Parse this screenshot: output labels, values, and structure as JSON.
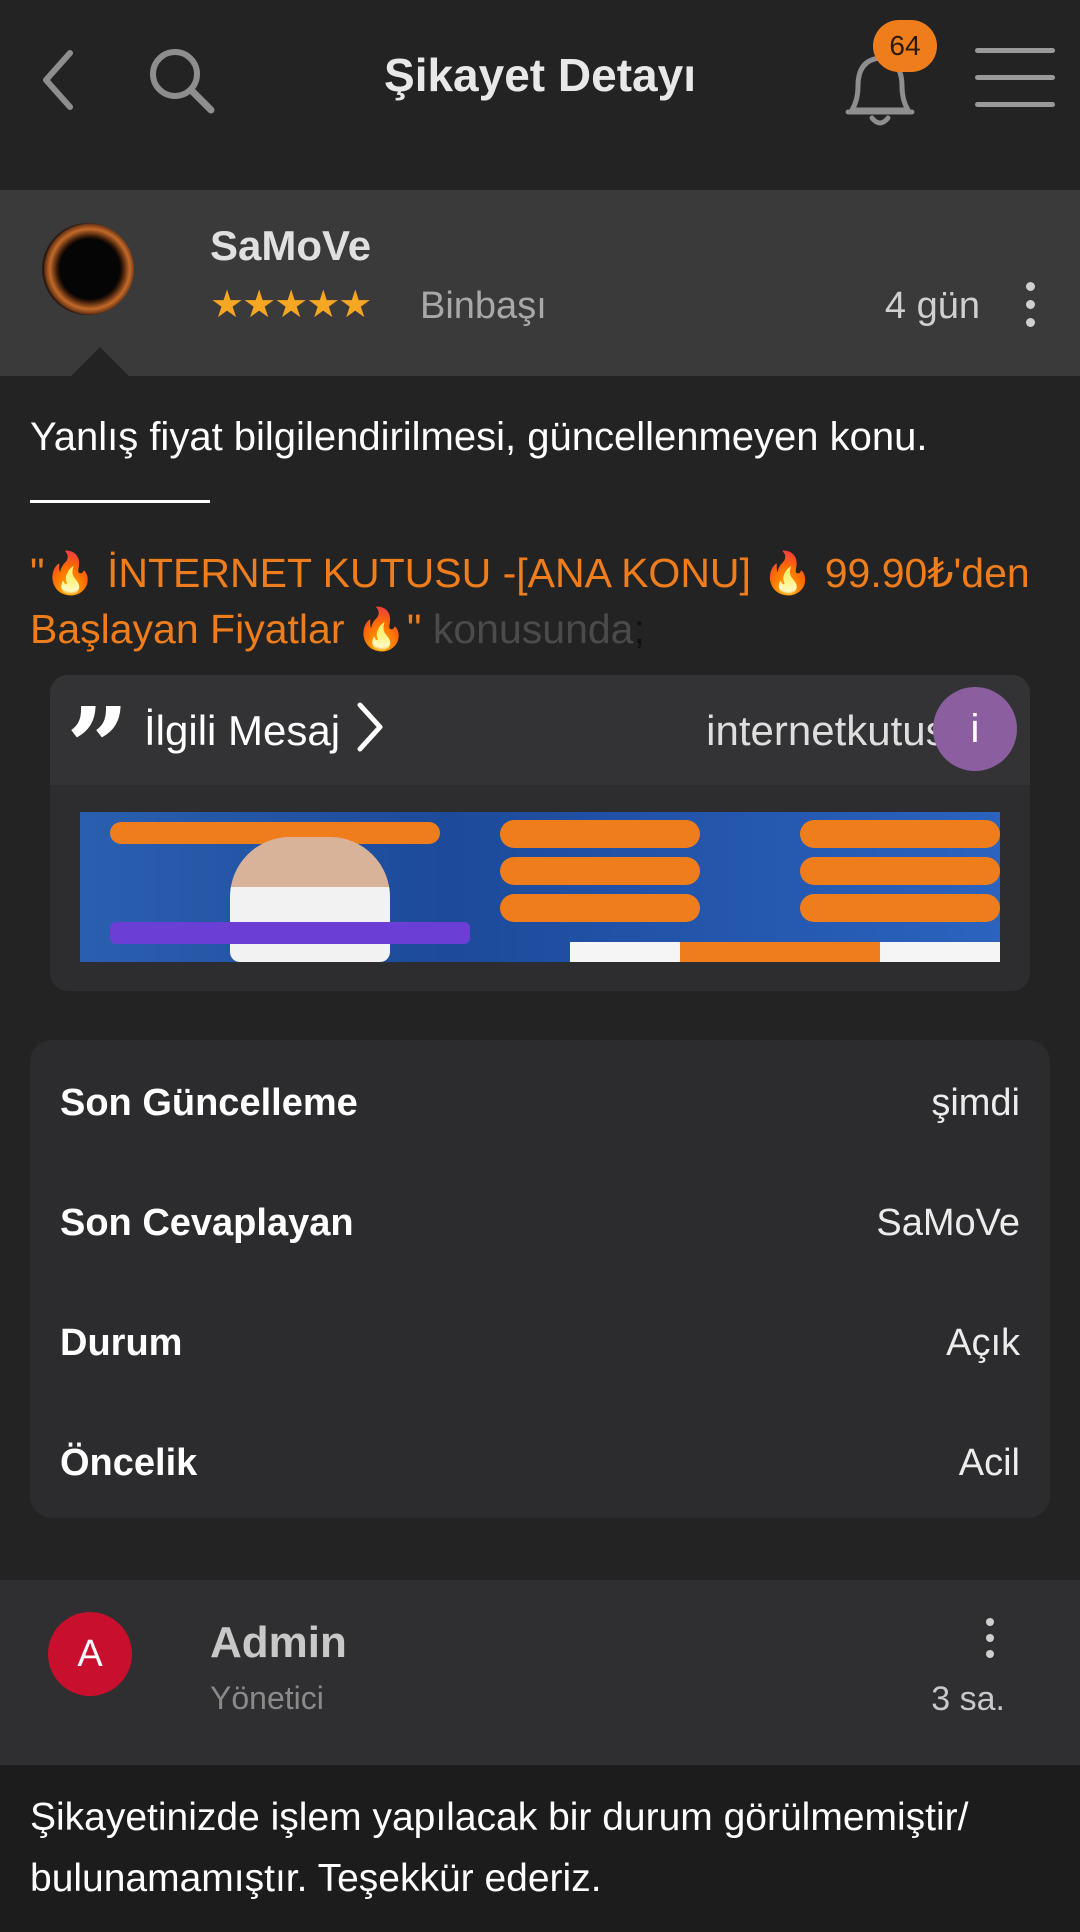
{
  "header": {
    "title": "Şikayet Detayı",
    "notification_count": "64",
    "icons": [
      "back-icon",
      "search-icon",
      "bell-icon",
      "hamburger-menu-icon"
    ]
  },
  "post": {
    "user_name": "SaMoVe",
    "stars": "★★★★★",
    "rank": "Binbaşı",
    "time": "4 gün",
    "title": "Yanlış fiyat bilgilendirilmesi, güncellenmeyen konu.",
    "topic_prefix": "\"🔥 İNTERNET KUTUSU -[ANA KONU] 🔥 99.90₺'den Başlayan Fiyatlar 🔥\"",
    "topic_suffix": " konusunda",
    "topic_semicolon": ";",
    "quote": {
      "label": "İlgili Mesaj",
      "user": "internetkutusu",
      "avatar_letter": "i"
    }
  },
  "info": {
    "rows": [
      {
        "key": "Son Güncelleme",
        "value": "şimdi"
      },
      {
        "key": "Son Cevaplayan",
        "value": "SaMoVe"
      },
      {
        "key": "Durum",
        "value": "Açık"
      },
      {
        "key": "Öncelik",
        "value": "Acil"
      }
    ]
  },
  "reply": {
    "avatar_letter": "A",
    "user_name": "Admin",
    "role": "Yönetici",
    "time": "3 sa.",
    "text": "Şikayetinizde işlem yapılacak bir durum görülmemiştir/ bulunamamıştır. Teşekkür ederiz."
  },
  "colors": {
    "accent_orange": "#f07d1c",
    "star_color": "#f5a623",
    "admin_red": "#c8102e",
    "quote_avatar_purple": "#8b5ea0"
  }
}
